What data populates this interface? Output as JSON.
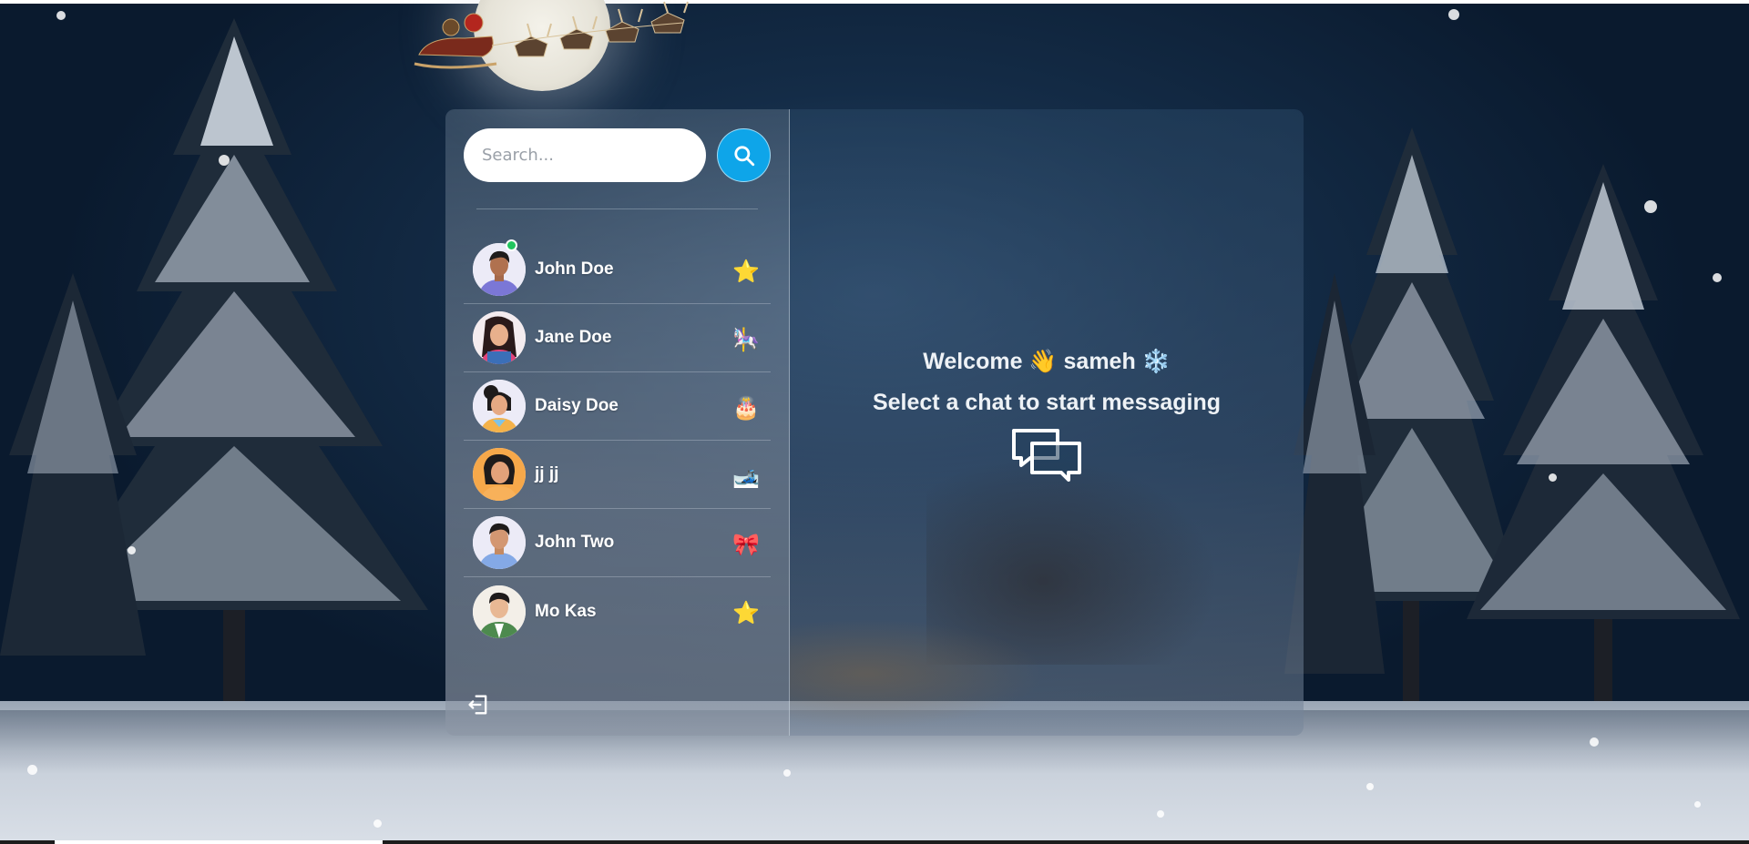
{
  "search": {
    "placeholder": "Search..."
  },
  "contacts": [
    {
      "name": "John Doe",
      "emoji": "⭐",
      "online": true
    },
    {
      "name": "Jane Doe",
      "emoji": "🎠",
      "online": false
    },
    {
      "name": "Daisy Doe",
      "emoji": "🎂",
      "online": false
    },
    {
      "name": "jj jj",
      "emoji": "🎿",
      "online": false
    },
    {
      "name": "John Two",
      "emoji": "🎀",
      "online": false
    },
    {
      "name": "Mo Kas",
      "emoji": "⭐",
      "online": false
    }
  ],
  "welcome": {
    "greeting": "Welcome 👋 sameh ❄️",
    "prompt": "Select a chat to start messaging"
  },
  "colors": {
    "accent": "#0ea5e9",
    "online": "#22c55e",
    "text": "#ffffff"
  },
  "icons": {
    "search_button": "search-icon",
    "logout": "logout-icon",
    "empty_state": "chat-bubbles-icon"
  }
}
